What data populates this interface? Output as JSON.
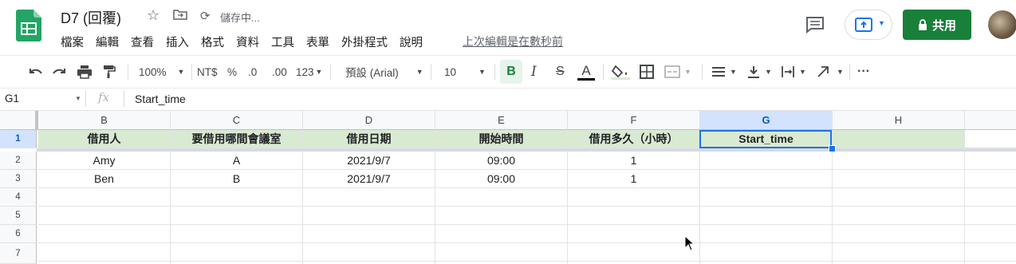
{
  "header": {
    "doc_title": "D7 (回覆)",
    "saving_status": "儲存中...",
    "last_edit": "上次編輯是在數秒前",
    "share_label": "共用"
  },
  "menu": [
    "檔案",
    "編輯",
    "查看",
    "插入",
    "格式",
    "資料",
    "工具",
    "表單",
    "外掛程式",
    "說明"
  ],
  "toolbar": {
    "zoom": "100%",
    "currency": "NT$",
    "percent": "%",
    "decrease_decimal": ".0",
    "increase_decimal": ".00",
    "more_formats": "123",
    "font": "預設 (Arial)",
    "font_size": "10",
    "bold": "B",
    "italic": "I",
    "strikethrough": "S",
    "text_color": "A",
    "more": "···"
  },
  "formula_bar": {
    "name_box": "G1",
    "fx": "fx",
    "content": "Start_time"
  },
  "grid": {
    "columns": [
      "B",
      "C",
      "D",
      "E",
      "F",
      "G",
      "H"
    ],
    "row_numbers": [
      "1",
      "2",
      "3",
      "4",
      "5",
      "6",
      "7"
    ],
    "header_row": [
      "借用人",
      "要借用哪間會議室",
      "借用日期",
      "開始時間",
      "借用多久（小時）",
      "Start_time",
      ""
    ],
    "rows": [
      [
        "Amy",
        "A",
        "2021/9/7",
        "09:00",
        "1",
        "",
        ""
      ],
      [
        "Ben",
        "B",
        "2021/9/7",
        "09:00",
        "1",
        "",
        ""
      ]
    ],
    "selected_cell": "G1",
    "header_fill": "#d9ead3",
    "accent": "#1a73e8",
    "brand_green": "#188038"
  }
}
